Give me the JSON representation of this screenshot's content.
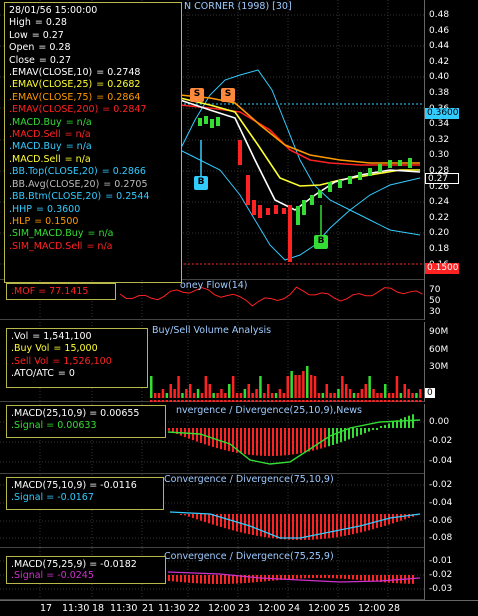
{
  "chart_title": "N CORNER (1998) [30]",
  "colors": {
    "white": "#ffffff",
    "yellow": "#ffff33",
    "orange": "#ff9900",
    "red": "#ff2222",
    "green": "#33dd33",
    "cyan": "#33ccff",
    "gray": "#bbbbbb"
  },
  "price_axis": {
    "ticks": [
      "0.48",
      "0.46",
      "0.44",
      "0.42",
      "0.40",
      "0.38",
      "0.36",
      "0.34",
      "0.32",
      "0.30",
      "0.28",
      "0.26",
      "0.24",
      "0.22",
      "0.20",
      "0.18",
      "0.16"
    ]
  },
  "badges": {
    "hhp": "0.3600",
    "last": "0.27",
    "hlp": "0.1500"
  },
  "signals": {
    "sell": "S",
    "buy_sim": "B",
    "buy": "B"
  },
  "info": {
    "date": "28/01/56 15:00:00",
    "lines": [
      {
        "label": "High",
        "value": "= 0.28",
        "color": "#ffffff"
      },
      {
        "label": "Low",
        "value": "= 0.27",
        "color": "#ffffff"
      },
      {
        "label": "Open",
        "value": "= 0.28",
        "color": "#ffffff"
      },
      {
        "label": "Close",
        "value": "= 0.27",
        "color": "#ffffff"
      },
      {
        "label": ".EMAV(CLOSE,10)",
        "value": "= 0.2748",
        "color": "#ffffff"
      },
      {
        "label": ".EMAV(CLOSE,25)",
        "value": "= 0.2682",
        "color": "#ffff33"
      },
      {
        "label": ".EMAV(CLOSE,75)",
        "value": "= 0.2864",
        "color": "#ff9900"
      },
      {
        "label": ".EMAV(CLOSE,200)",
        "value": "= 0.2847",
        "color": "#ff2222"
      },
      {
        "label": ".MACD.Buy",
        "value": "= n/a",
        "color": "#33dd33"
      },
      {
        "label": ".MACD.Sell",
        "value": "= n/a",
        "color": "#ff2222"
      },
      {
        "label": ".MACD.Buy",
        "value": "= n/a",
        "color": "#33ccff"
      },
      {
        "label": ".MACD.Sell",
        "value": "= n/a",
        "color": "#ffff33"
      },
      {
        "label": ".BB.Top(CLOSE,20)",
        "value": "= 0.2866",
        "color": "#33ccff"
      },
      {
        "label": ".BB.Avg(CLOSE,20)",
        "value": "= 0.2705",
        "color": "#bbbbbb"
      },
      {
        "label": ".BB.Btm(CLOSE,20)",
        "value": "= 0.2544",
        "color": "#33ccff"
      },
      {
        "label": ".HHP",
        "value": "= 0.3600",
        "color": "#33ccff"
      },
      {
        "label": ".HLP",
        "value": "= 0.1500",
        "color": "#ff9900"
      },
      {
        "label": ".SIM_MACD.Buy",
        "value": "= n/a",
        "color": "#33dd33"
      },
      {
        "label": ".SIM_MACD.Sell",
        "value": "= n/a",
        "color": "#ff2222"
      }
    ]
  },
  "mof": {
    "label": ".MOF",
    "value": "= 77.1415",
    "title": "oney Flow(14)",
    "ticks": [
      "70",
      "50",
      "30"
    ]
  },
  "volume": {
    "title": "Buy/Sell Volume Analysis",
    "lines": [
      {
        "label": ".Vol",
        "value": "= 1,541,100",
        "color": "#ffffff"
      },
      {
        "label": ".Buy Vol",
        "value": "= 15,000",
        "color": "#ffff33"
      },
      {
        "label": ".Sell Vol",
        "value": "= 1,526,100",
        "color": "#ff2222"
      },
      {
        "label": ".ATO/ATC",
        "value": "= 0",
        "color": "#ffffff"
      }
    ],
    "ticks": [
      "90M",
      "60M",
      "30M",
      "0"
    ]
  },
  "macd1": {
    "title": "nvergence / Divergence(25,10,9),News",
    "macd_label": ".MACD(25,10,9)",
    "macd_value": "= 0.00655",
    "signal_label": ".Signal",
    "signal_value": "= 0.00633",
    "ticks": [
      "0.00",
      "-0.02",
      "-0.04"
    ]
  },
  "macd2": {
    "title": "Convergence / Divergence(75,10,9)",
    "macd_label": ".MACD(75,10,9)",
    "macd_value": "= -0.0116",
    "signal_label": ".Signal",
    "signal_value": "= -0.0167",
    "ticks": [
      "-0.02",
      "-0.04",
      "-0.06",
      "-0.08"
    ]
  },
  "macd3": {
    "title": "Convergence / Divergence(75,25,9)",
    "macd_label": ".MACD(75,25,9)",
    "macd_value": "= -0.0182",
    "signal_label": ".Signal",
    "signal_value": "= -0.0245",
    "ticks": [
      "-0.01",
      "-0.02",
      "-0.03"
    ]
  },
  "time_axis": [
    "17",
    "11:30",
    "18",
    "11:30",
    "21",
    "11:30",
    "22",
    "12:00",
    "23",
    "12:00",
    "24",
    "12:00",
    "25",
    "12:00",
    "28"
  ]
}
